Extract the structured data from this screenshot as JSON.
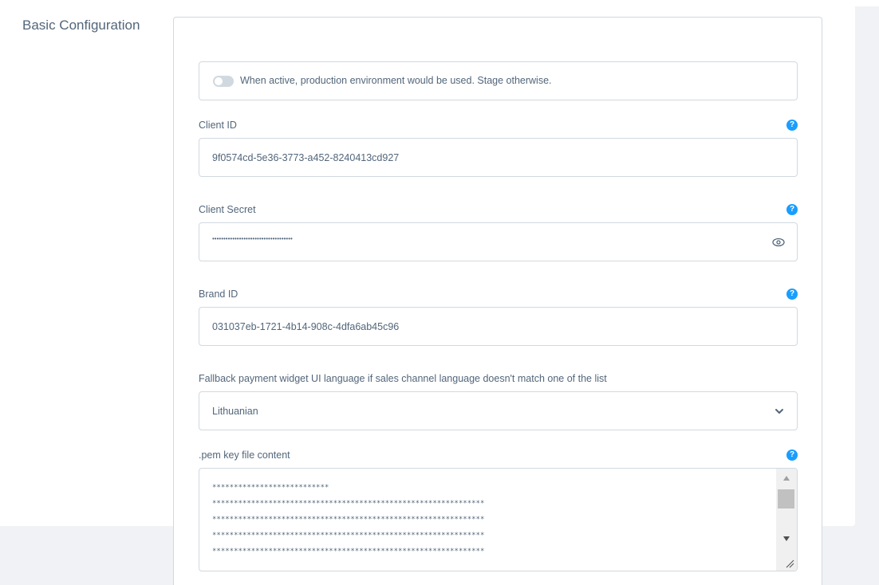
{
  "section": {
    "title": "Basic Configuration"
  },
  "toggle": {
    "label": "When active, production environment would be used. Stage otherwise.",
    "active": false
  },
  "client_id": {
    "label": "Client ID",
    "value": "9f0574cd-5e36-3773-a452-8240413cd927",
    "help": "?"
  },
  "client_secret": {
    "label": "Client Secret",
    "value": "••••••••••••••••••••••••••••••••••••",
    "help": "?",
    "reveal_icon": "eye-icon"
  },
  "brand_id": {
    "label": "Brand ID",
    "value": "031037eb-1721-4b14-908c-4dfa6ab45c96",
    "help": "?"
  },
  "fallback_language": {
    "label": "Fallback payment widget UI language if sales channel language doesn't match one of the list",
    "selected": "Lithuanian",
    "dropdown_icon": "chevron-down-icon"
  },
  "pem_key": {
    "label": ".pem key file content",
    "help": "?",
    "lines": [
      "***************************",
      "***************************************************************",
      "***************************************************************",
      "***************************************************************",
      "***************************************************************"
    ]
  },
  "colors": {
    "accent": "#189eff",
    "border": "#d1d9e0",
    "text": "#52667a"
  }
}
